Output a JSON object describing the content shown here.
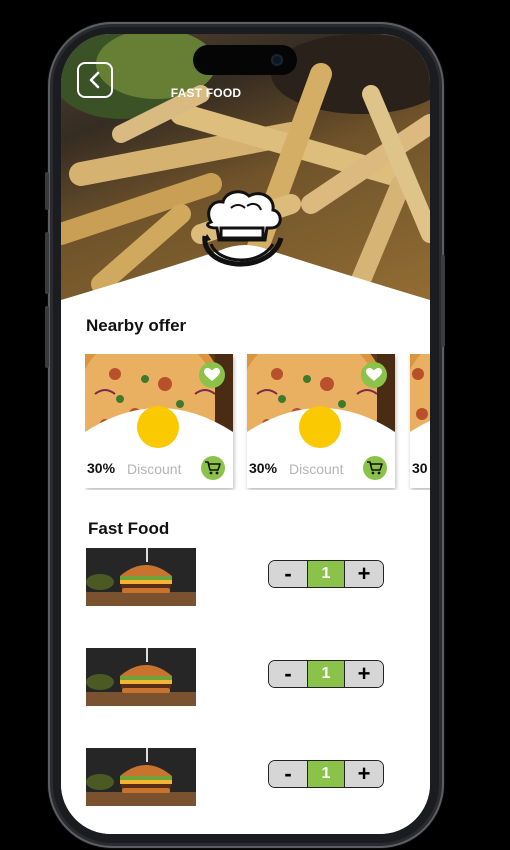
{
  "header": {
    "title": "FAST FOOD"
  },
  "nearby": {
    "title": "Nearby offer",
    "offers": [
      {
        "percent": "30%",
        "label": "Discount"
      },
      {
        "percent": "30%",
        "label": "Discount"
      },
      {
        "percent": "30",
        "label": ""
      }
    ]
  },
  "fastfood": {
    "title": "Fast Food",
    "items": [
      {
        "minus": "-",
        "qty": "1",
        "plus": "+"
      },
      {
        "minus": "-",
        "qty": "1",
        "plus": "+"
      },
      {
        "minus": "-",
        "qty": "1",
        "plus": "+"
      }
    ]
  },
  "colors": {
    "accent": "#8bc34a",
    "highlight": "#fbc900"
  },
  "icons": [
    "back-arrow-icon",
    "chef-hat-logo",
    "heart-icon",
    "cart-icon"
  ]
}
